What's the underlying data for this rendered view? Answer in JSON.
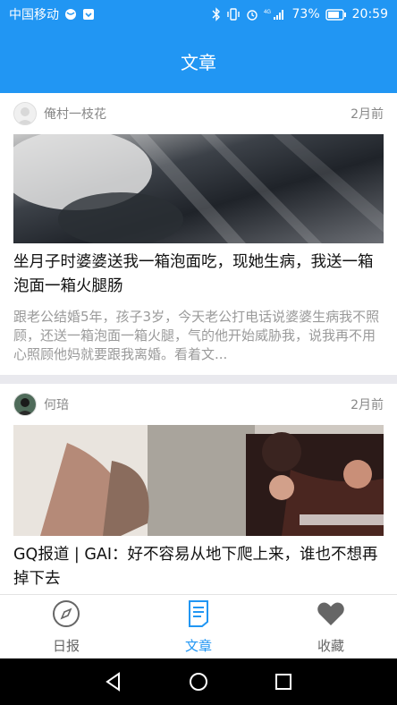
{
  "status_bar": {
    "carrier": "中国移动",
    "network_label": "4G",
    "battery_percent": "73%",
    "time": "20:59"
  },
  "app_bar": {
    "title": "文章"
  },
  "articles": [
    {
      "author": "俺村一枝花",
      "time": "2月前",
      "title": "坐月子时婆婆送我一箱泡面吃，现她生病，我送一箱泡面一箱火腿肠",
      "summary": "跟老公结婚5年，孩子3岁，今天老公打电话说婆婆生病我不照顾，还送一箱泡面一箱火腿，气的他开始威胁我，说我再不用心照顾他妈就要跟我离婚。看着文..."
    },
    {
      "author": "何琣",
      "time": "2月前",
      "title": "GQ报道 | GAI：好不容易从地下爬上来，谁也不想再掉下去",
      "summary": ""
    }
  ],
  "tab_bar": {
    "tabs": [
      {
        "label": "日报",
        "icon": "compass-icon"
      },
      {
        "label": "文章",
        "icon": "document-icon"
      },
      {
        "label": "收藏",
        "icon": "heart-icon"
      }
    ],
    "active_index": 1
  },
  "nav_bar": {
    "buttons": [
      "back",
      "home",
      "recents"
    ]
  },
  "colors": {
    "primary": "#2196f3",
    "background": "#e9e9ee"
  }
}
